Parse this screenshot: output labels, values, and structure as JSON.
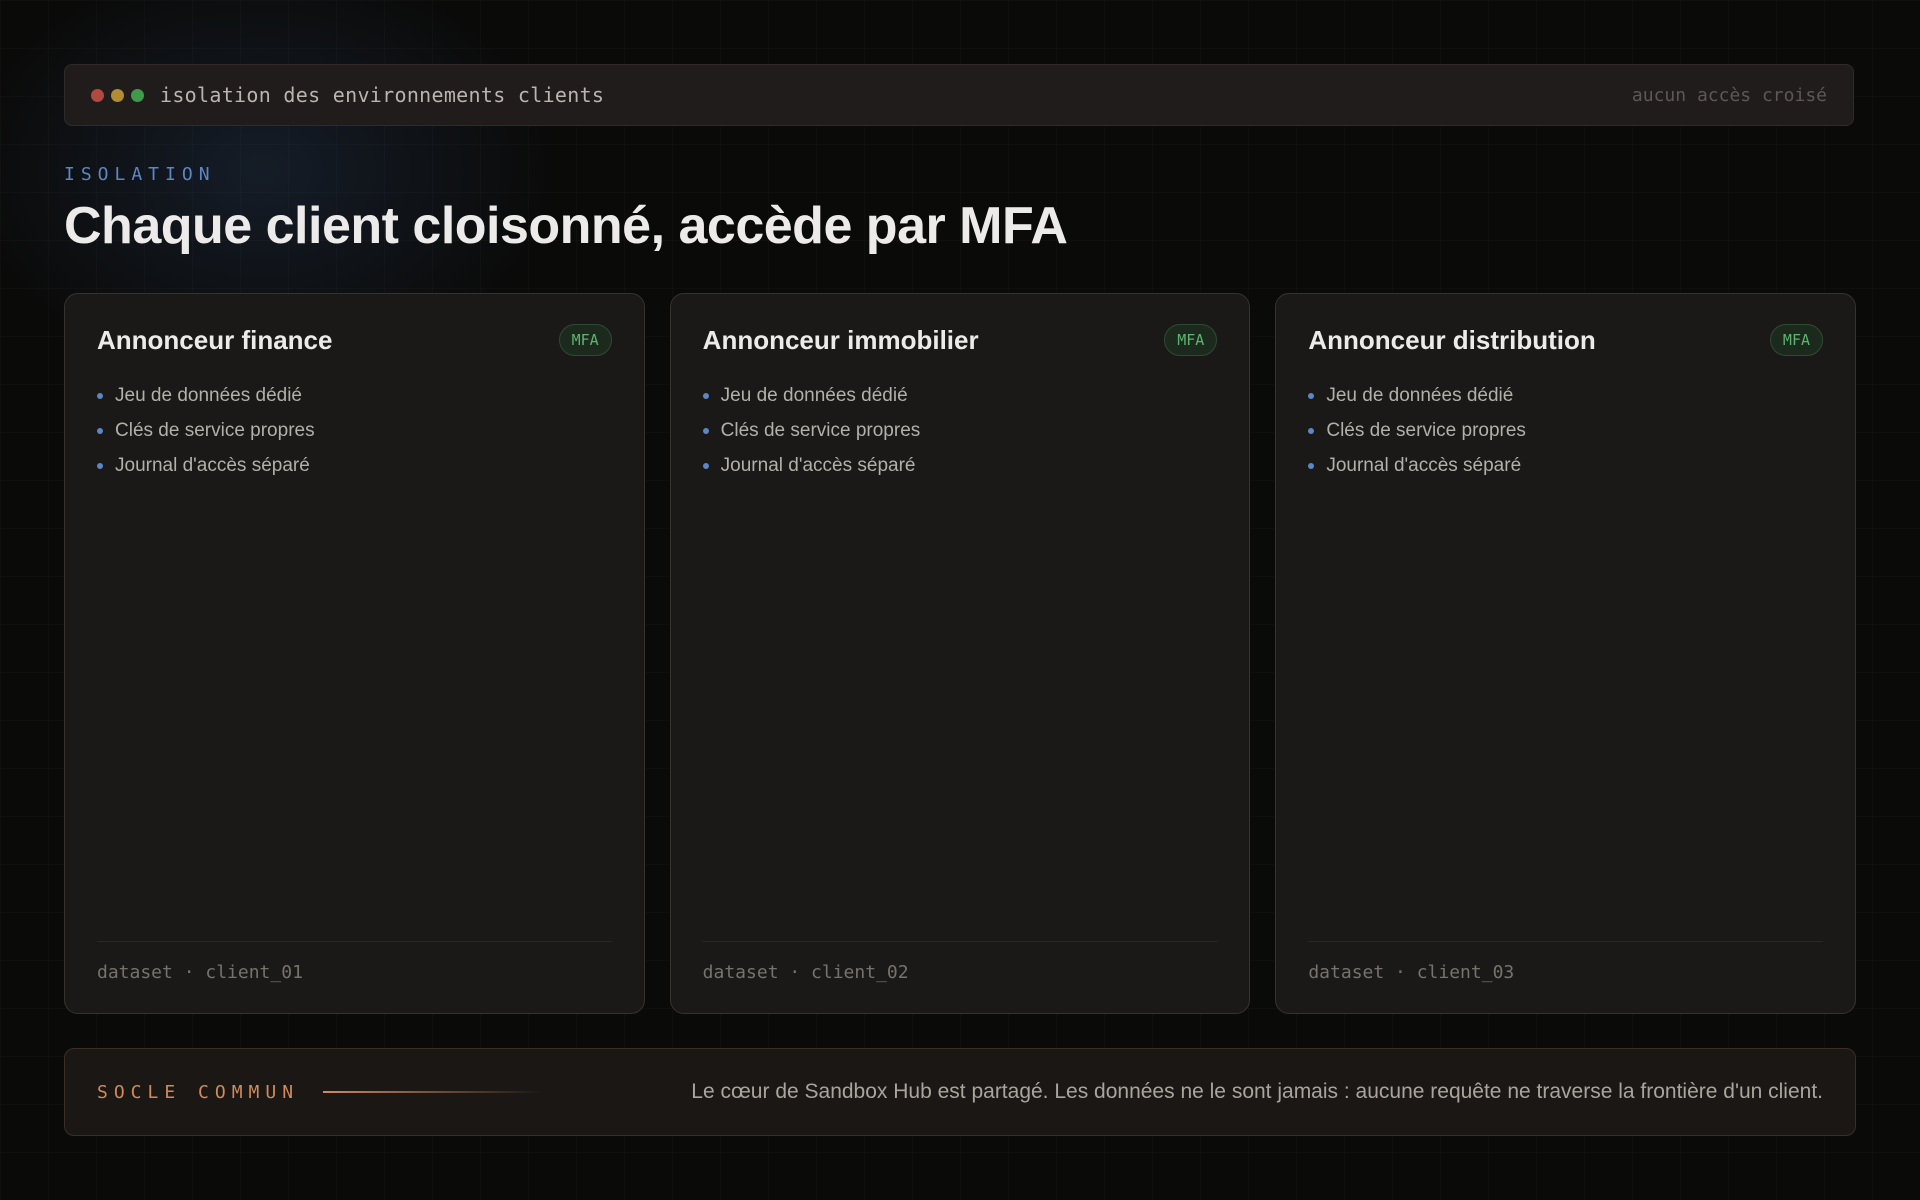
{
  "titlebar": {
    "title": "isolation des environnements clients",
    "right_text": "aucun accès croisé",
    "dot_colors": [
      "#b04a3e",
      "#b08c34",
      "#3f9a4c"
    ]
  },
  "header": {
    "eyebrow": "ISOLATION",
    "title": "Chaque client cloisonné, accède par MFA"
  },
  "cards": [
    {
      "title": "Annonceur finance",
      "badge": "MFA",
      "features": [
        "Jeu de données dédié",
        "Clés de service propres",
        "Journal d'accès séparé"
      ],
      "footer": "dataset · client_01"
    },
    {
      "title": "Annonceur immobilier",
      "badge": "MFA",
      "features": [
        "Jeu de données dédié",
        "Clés de service propres",
        "Journal d'accès séparé"
      ],
      "footer": "dataset · client_02"
    },
    {
      "title": "Annonceur distribution",
      "badge": "MFA",
      "features": [
        "Jeu de données dédié",
        "Clés de service propres",
        "Journal d'accès séparé"
      ],
      "footer": "dataset · client_03"
    }
  ],
  "socle": {
    "label": "SOCLE COMMUN",
    "text": "Le cœur de Sandbox Hub est partagé. Les données ne le sont jamais : aucune requête ne traverse la frontière d'un client."
  },
  "colors": {
    "accent_blue": "#5d86c4",
    "badge_green": "#5fb26f",
    "accent_orange": "#d18a5c"
  }
}
